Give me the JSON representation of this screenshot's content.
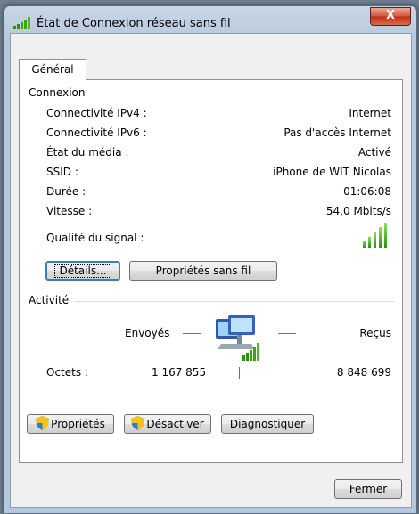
{
  "window": {
    "title": "État de Connexion réseau sans fil",
    "close_label": "X"
  },
  "tabs": [
    {
      "label": "Général"
    }
  ],
  "connexion": {
    "group_label": "Connexion",
    "rows": [
      {
        "label": "Connectivité IPv4 :",
        "value": "Internet"
      },
      {
        "label": "Connectivité IPv6 :",
        "value": "Pas d'accès Internet"
      },
      {
        "label": "État du média :",
        "value": "Activé"
      },
      {
        "label": "SSID :",
        "value": "iPhone de WIT Nicolas"
      },
      {
        "label": "Durée :",
        "value": "01:06:08"
      },
      {
        "label": "Vitesse :",
        "value": "54,0 Mbits/s"
      }
    ],
    "signal_label": "Qualité du signal :",
    "signal_level": "5/5",
    "details_button": "Détails...",
    "wireless_props_button": "Propriétés sans fil"
  },
  "activite": {
    "group_label": "Activité",
    "sent_label": "Envoyés",
    "received_label": "Reçus",
    "bytes_label": "Octets :",
    "bytes_sent": "1 167 855",
    "bytes_received": "8 848 699"
  },
  "bottom_buttons": {
    "properties": "Propriétés",
    "disable": "Désactiver",
    "diagnose": "Diagnostiquer"
  },
  "footer": {
    "close_button": "Fermer"
  }
}
